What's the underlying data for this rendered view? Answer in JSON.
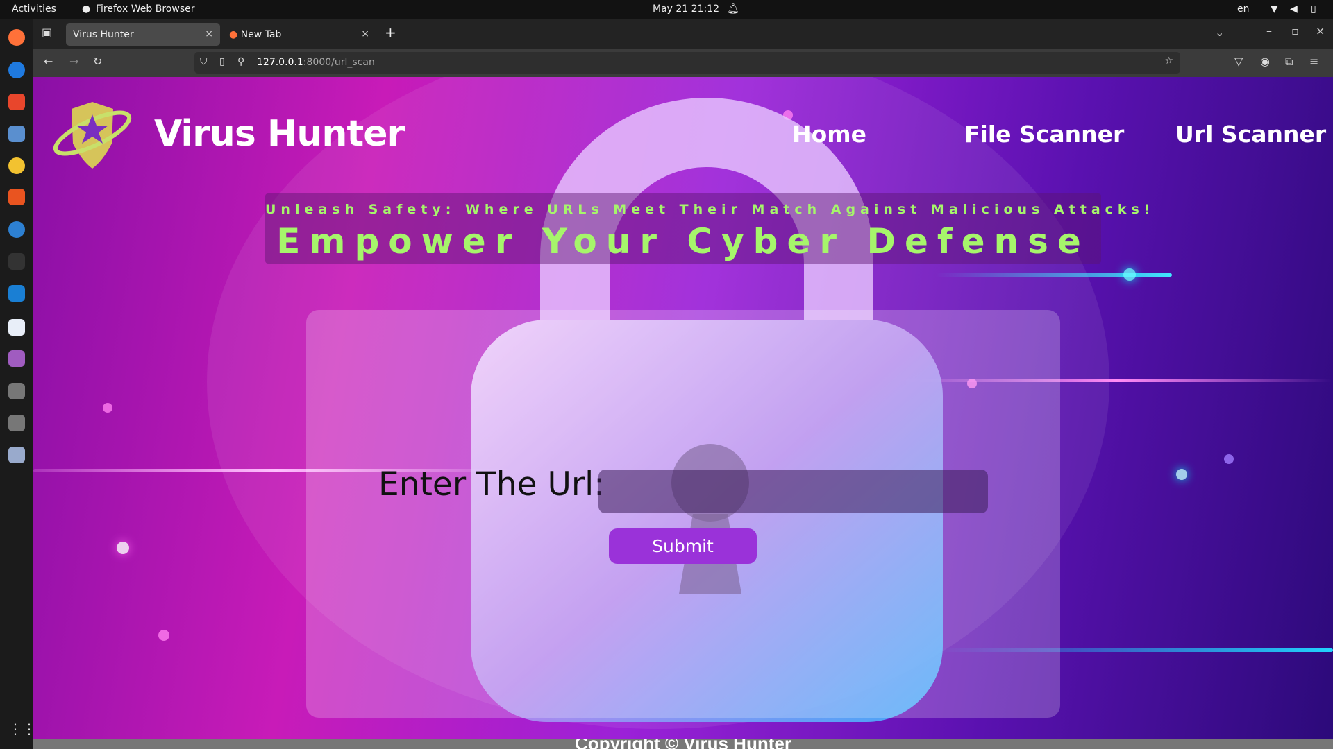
{
  "system_bar": {
    "activities": "Activities",
    "app_name": "Firefox Web Browser",
    "datetime": "May 21  21:12",
    "language": "en"
  },
  "browser": {
    "tabs": [
      {
        "title": "Virus Hunter",
        "active": true
      },
      {
        "title": "New Tab",
        "active": false
      }
    ],
    "url_host": "127.0.0.1",
    "url_path": ":8000/url_scan"
  },
  "site": {
    "brand": "Virus Hunter",
    "nav": [
      {
        "label": "Home"
      },
      {
        "label": "File Scanner"
      },
      {
        "label": "Url Scanner"
      }
    ],
    "tagline": "Unleash Safety: Where URLs Meet Their Match Against Malicious Attacks!",
    "headline": "Empower Your Cyber Defense",
    "form": {
      "label": "Enter The Url:",
      "input_value": "",
      "submit_label": "Submit"
    },
    "footer": "Copyright © Virus Hunter"
  },
  "colors": {
    "accent_green": "#a6f56b",
    "button": "#9a32d9",
    "footer": "#777777"
  }
}
